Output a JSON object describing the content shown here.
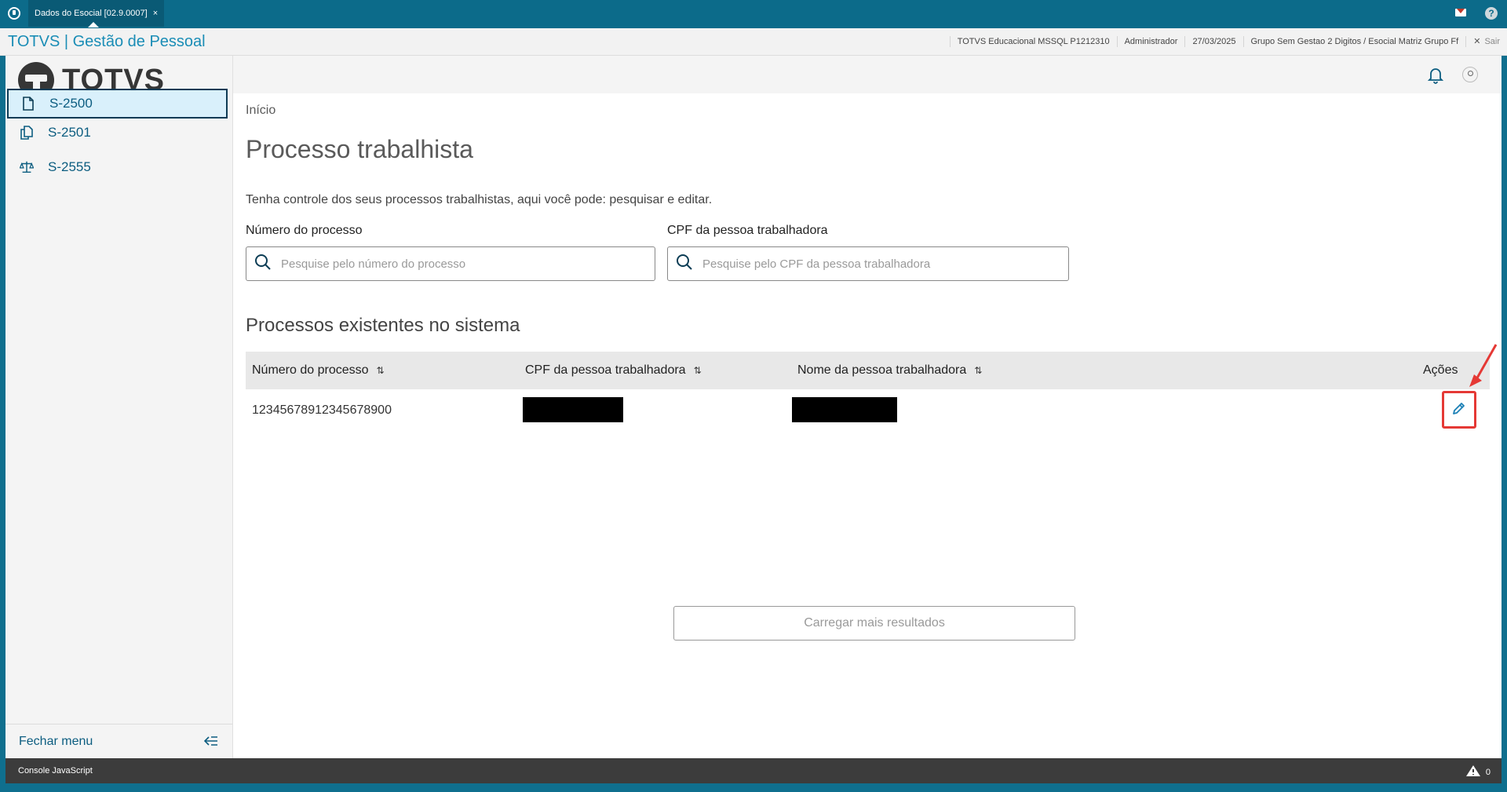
{
  "window": {
    "tab_title": "Dados do Esocial [02.9.0007]",
    "tab_close": "×"
  },
  "header": {
    "app_title": "TOTVS | Gestão de Pessoal",
    "info": [
      "TOTVS Educacional MSSQL P1212310",
      "Administrador",
      "27/03/2025",
      "Grupo Sem Gestao 2 Digitos / Esocial Matriz Grupo Ff"
    ],
    "exit_label": "Sair"
  },
  "sidebar": {
    "logo_text": "TOTVS",
    "items": [
      {
        "label": "S-2500",
        "icon": "document-icon",
        "active": true
      },
      {
        "label": "S-2501",
        "icon": "copy-documents-icon",
        "active": false
      },
      {
        "label": "S-2555",
        "icon": "scale-icon",
        "active": false
      }
    ],
    "close_menu": "Fechar menu"
  },
  "main": {
    "breadcrumb": "Início",
    "title": "Processo trabalhista",
    "description": "Tenha controle dos seus processos trabalhistas, aqui você pode: pesquisar e editar.",
    "filters": {
      "process_label": "Número do processo",
      "process_placeholder": "Pesquise pelo número do processo",
      "cpf_label": "CPF da pessoa trabalhadora",
      "cpf_placeholder": "Pesquise pelo CPF da pessoa trabalhadora"
    },
    "section_title": "Processos existentes no sistema",
    "table": {
      "columns": [
        "Número do processo",
        "CPF da pessoa trabalhadora",
        "Nome da pessoa trabalhadora",
        "Ações"
      ],
      "rows": [
        {
          "process_number": "12345678912345678900",
          "cpf": "",
          "name": ""
        }
      ]
    },
    "load_more": "Carregar mais resultados"
  },
  "footer": {
    "console_label": "Console JavaScript",
    "warning_count": "0"
  },
  "colors": {
    "brand": "#0c6b8a",
    "link": "#0c5d80",
    "highlight": "#e53935"
  }
}
